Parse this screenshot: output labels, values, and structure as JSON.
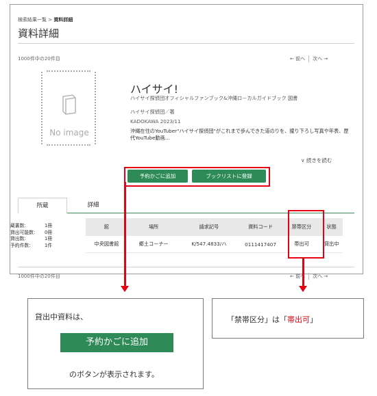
{
  "breadcrumb": {
    "parent": "検索結果一覧",
    "sep": ">",
    "current": "資料詳細"
  },
  "page": {
    "title": "資料詳細"
  },
  "pagination": {
    "count_text": "1000件中の20件目",
    "prev_label": "← 前へ",
    "next_label": "次へ →"
  },
  "book": {
    "noimage_label": "No image",
    "title": "ハイサイ!",
    "subtitle": "ハイサイ探偵団オフィシャルファンブック&沖縄ロ－カルガイドブック 図書",
    "author": "ハイサイ探偵団／著",
    "publisher": "KADOKAWA 2023/11",
    "summary": "沖縄在住のYouTuber\"ハイサイ探偵団\"がこれまで歩んできた道のりを、撮り下ろし写真や年表、歴代YouTube動画…",
    "more_label": "∨ 続きを読む"
  },
  "actions": {
    "cart_label": "予約かごに追加",
    "booklist_label": "ブックリストに登録"
  },
  "tabs": [
    {
      "label": "所蔵"
    },
    {
      "label": "詳細"
    }
  ],
  "stats": [
    {
      "label": "蔵書数:",
      "value": "1冊"
    },
    {
      "label": "貸出可能数:",
      "value": "0冊"
    },
    {
      "label": "貸出数:",
      "value": "1冊"
    },
    {
      "label": "予約件数:",
      "value": "1件"
    }
  ],
  "holdings": {
    "headers": [
      "館",
      "場所",
      "請求記号",
      "資料コード",
      "禁帯区分",
      "状態"
    ],
    "rows": [
      [
        "中央図書館",
        "郷土コーナー",
        "K/547.4833/ハ",
        "0111417407",
        "帯出可",
        "貸出中"
      ]
    ]
  },
  "callout_left": {
    "line1": "貸出中資料は、",
    "button_label": "予約かごに追加",
    "line2": "のボタンが表示されます。"
  },
  "callout_right": {
    "prefix": "「禁帯区分」は「",
    "highlight": "帯出可",
    "suffix": "」"
  },
  "colors": {
    "accent_green": "#2e8b57",
    "highlight_red": "#e60012"
  }
}
